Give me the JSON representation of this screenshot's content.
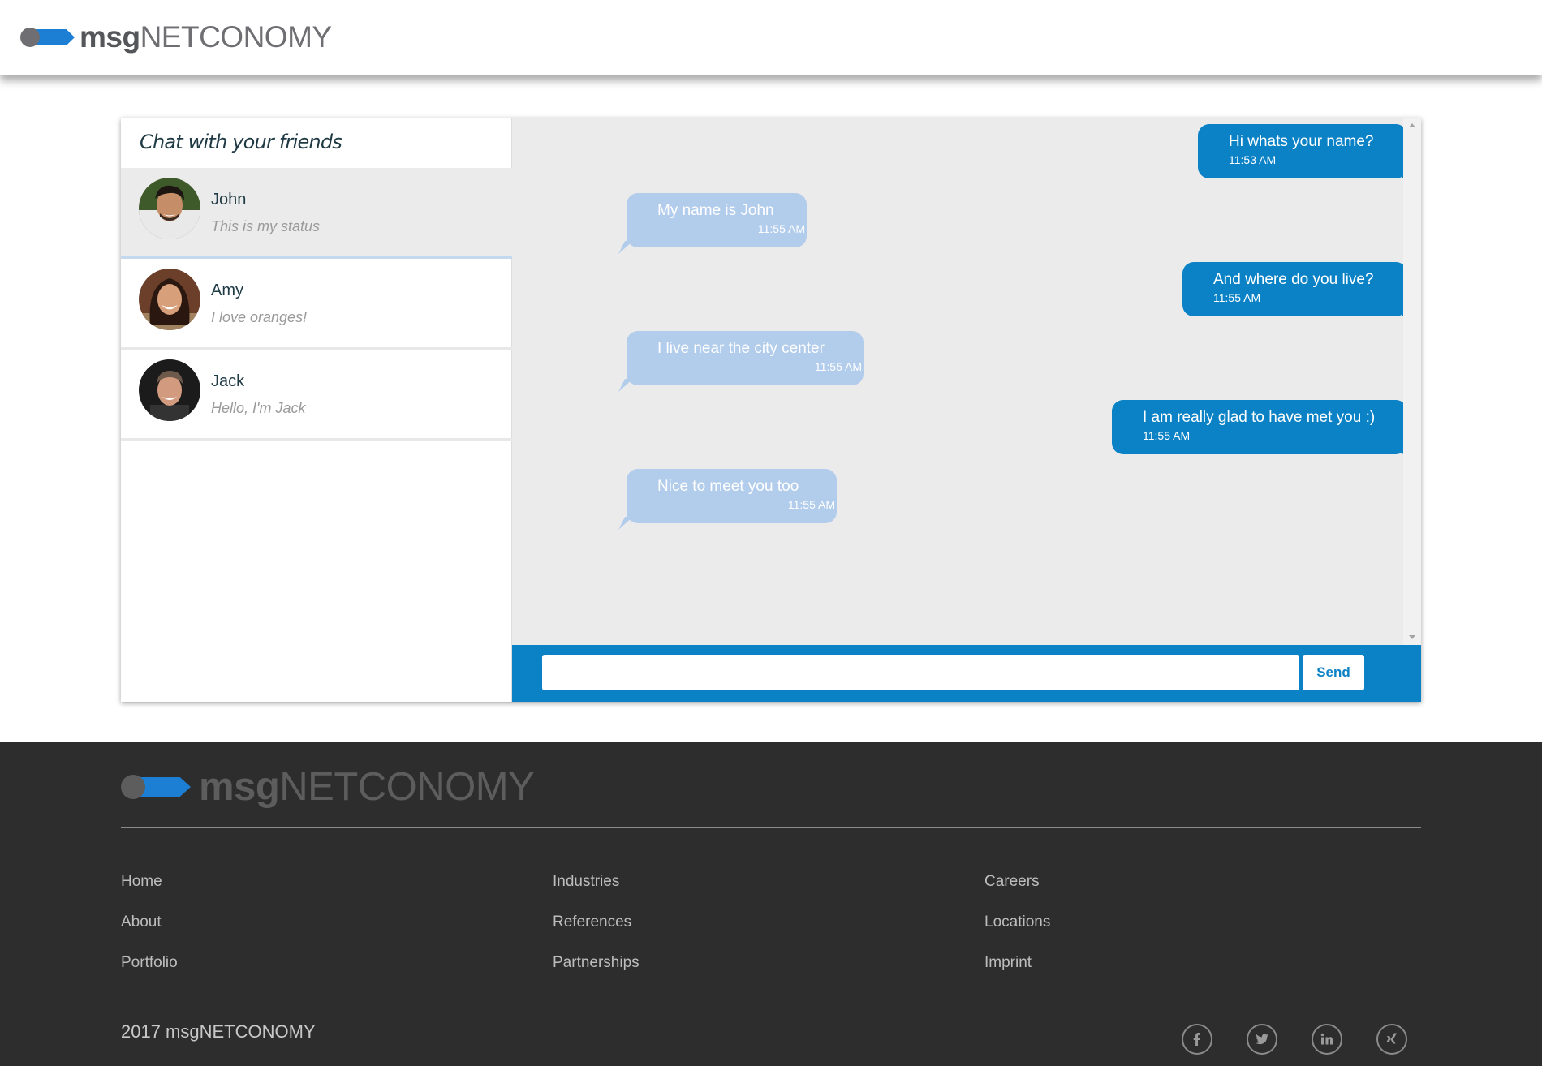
{
  "header": {
    "logo_bold": "msg",
    "logo_light": "NETCONOMY"
  },
  "sidebar": {
    "title": "Chat with your friends",
    "friends": [
      {
        "name": "John",
        "status": "This is my status",
        "active": true
      },
      {
        "name": "Amy",
        "status": "I love oranges!",
        "active": false
      },
      {
        "name": "Jack",
        "status": "Hello, I'm Jack",
        "active": false
      }
    ]
  },
  "messages": [
    {
      "direction": "sent",
      "text": "Hi whats your name?",
      "time": "11:53 AM"
    },
    {
      "direction": "received",
      "text": "My name is John",
      "time": "11:55 AM"
    },
    {
      "direction": "sent",
      "text": "And where do you live?",
      "time": "11:55 AM"
    },
    {
      "direction": "received",
      "text": "I live near the city center",
      "time": "11:55 AM"
    },
    {
      "direction": "sent",
      "text": "I am really glad to have met you :)",
      "time": "11:55 AM"
    },
    {
      "direction": "received",
      "text": "Nice to meet you too",
      "time": "11:55 AM"
    }
  ],
  "composer": {
    "value": "",
    "send_label": "Send"
  },
  "footer": {
    "logo_bold": "msg",
    "logo_light": "NETCONOMY",
    "columns": [
      [
        "Home",
        "About",
        "Portfolio"
      ],
      [
        "Industries",
        "References",
        "Partnerships"
      ],
      [
        "Careers",
        "Locations",
        "Imprint"
      ]
    ],
    "copyright": "2017 msgNETCONOMY",
    "socials": [
      "facebook-icon",
      "twitter-icon",
      "linkedin-icon",
      "xing-icon"
    ]
  },
  "colors": {
    "accent": "#0b82c6",
    "received_bubble": "#b2cceb",
    "footer_bg": "#2d2d2d",
    "chat_bg": "#ebebeb"
  }
}
